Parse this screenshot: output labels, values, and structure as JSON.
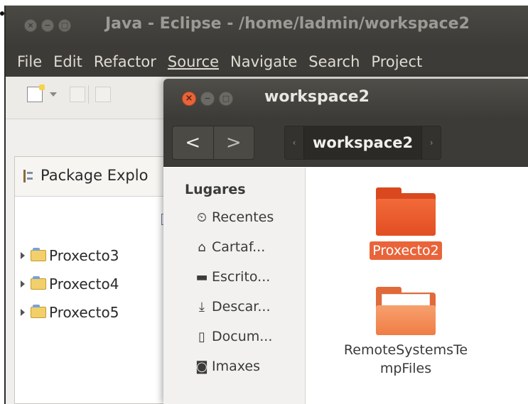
{
  "eclipse": {
    "title": "Java - Eclipse - /home/ladmin/workspace2",
    "menu": [
      "File",
      "Edit",
      "Refactor",
      "Source",
      "Navigate",
      "Search",
      "Project"
    ],
    "package_explorer": {
      "tab_label": "Package Explo",
      "projects": [
        "Proxecto3",
        "Proxecto4",
        "Proxecto5"
      ]
    }
  },
  "file_manager": {
    "title": "workspace2",
    "nav": {
      "back": "<",
      "forward": ">"
    },
    "breadcrumb": {
      "left_arrow": "‹",
      "segment": "workspace2",
      "right_arrow": "›"
    },
    "sidebar": {
      "heading": "Lugares",
      "items": [
        {
          "label": "Recentes",
          "icon": "clock-icon"
        },
        {
          "label": "Cartaf...",
          "icon": "home-icon"
        },
        {
          "label": "Escrito...",
          "icon": "desktop-folder-icon"
        },
        {
          "label": "Descar...",
          "icon": "download-icon"
        },
        {
          "label": "Docum...",
          "icon": "document-icon"
        },
        {
          "label": "Imaxes",
          "icon": "camera-icon"
        }
      ]
    },
    "items": [
      {
        "label": "Proxecto2",
        "selected": true
      },
      {
        "label_line1": "RemoteSystemsTe",
        "label_line2": "mpFiles",
        "selected": false
      }
    ]
  },
  "colors": {
    "accent": "#e9643a",
    "titlebar": "#3c3b37"
  }
}
